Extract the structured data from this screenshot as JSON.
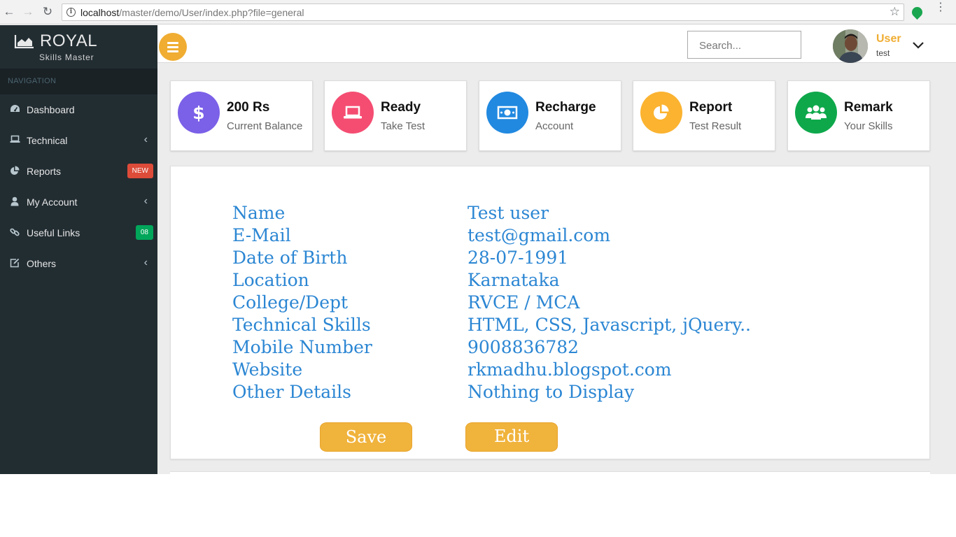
{
  "browser": {
    "url_host": "localhost",
    "url_path": "/master/demo/User/index.php?file=general"
  },
  "brand": {
    "title": "ROYAL",
    "subtitle": "Skills Master"
  },
  "sidebar": {
    "header": "NAVIGATION",
    "items": [
      {
        "label": "Dashboard",
        "icon": "dashboard-icon"
      },
      {
        "label": "Technical",
        "icon": "laptop-icon",
        "has_submenu": true
      },
      {
        "label": "Reports",
        "icon": "pie-chart-icon",
        "badge": "NEW",
        "badge_color": "#dd4b39"
      },
      {
        "label": "My Account",
        "icon": "user-icon",
        "has_submenu": true
      },
      {
        "label": "Useful Links",
        "icon": "link-icon",
        "badge": "08",
        "badge_color": "#00a65a"
      },
      {
        "label": "Others",
        "icon": "edit-icon",
        "has_submenu": true
      }
    ]
  },
  "topbar": {
    "search_placeholder": "Search...",
    "user_name": "User",
    "user_sub": "test"
  },
  "cards": [
    {
      "title": "200 Rs",
      "sub": "Current Balance",
      "color": "#7b60e8",
      "icon": "dollar-icon"
    },
    {
      "title": "Ready",
      "sub": "Take Test",
      "color": "#f54d72",
      "icon": "laptop-icon"
    },
    {
      "title": "Recharge",
      "sub": "Account",
      "color": "#2189e0",
      "icon": "money-icon"
    },
    {
      "title": "Report",
      "sub": "Test Result",
      "color": "#fbb330",
      "icon": "pie-chart-icon"
    },
    {
      "title": "Remark",
      "sub": "Your Skills",
      "color": "#0ea84b",
      "icon": "users-icon"
    }
  ],
  "profile": {
    "rows": [
      {
        "label": "Name",
        "value": "Test user"
      },
      {
        "label": "E-Mail",
        "value": "test@gmail.com"
      },
      {
        "label": "Date of Birth",
        "value": "28-07-1991"
      },
      {
        "label": "Location",
        "value": "Karnataka"
      },
      {
        "label": "College/Dept",
        "value": "RVCE / MCA"
      },
      {
        "label": "Technical Skills",
        "value": "HTML, CSS, Javascript, jQuery.."
      },
      {
        "label": "Mobile Number",
        "value": "9008836782"
      },
      {
        "label": "Website",
        "value": "rkmadhu.blogspot.com"
      },
      {
        "label": "Other Details",
        "value": "Nothing to Display"
      }
    ],
    "save_label": "Save",
    "edit_label": "Edit"
  }
}
